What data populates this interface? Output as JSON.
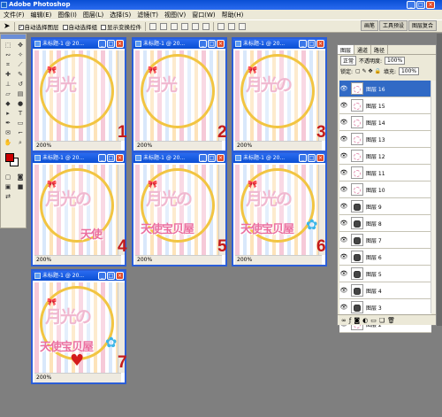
{
  "app": {
    "title": "Adobe Photoshop"
  },
  "window_controls": [
    "_",
    "□",
    "×"
  ],
  "menu": [
    "文件(F)",
    "编辑(E)",
    "图像(I)",
    "图层(L)",
    "选择(S)",
    "滤镜(T)",
    "视图(V)",
    "窗口(W)",
    "帮助(H)"
  ],
  "options": {
    "auto_select_layer": "自动选择图层",
    "auto_select_group": "自动选择组",
    "show_transform": "显示变换控件"
  },
  "wells": [
    "画笔",
    "工具预设",
    "图层复合"
  ],
  "documents": [
    {
      "title": "未标题-1 @ 20...",
      "zoom": "200%",
      "label": "1",
      "line1": "月光",
      "line2": "",
      "flower": false,
      "heart": false
    },
    {
      "title": "未标题-1 @ 20...",
      "zoom": "200%",
      "label": "2",
      "line1": "月光",
      "line2": "",
      "flower": false,
      "heart": false
    },
    {
      "title": "未标题-1 @ 20...",
      "zoom": "200%",
      "label": "3",
      "line1": "月光の",
      "line2": "",
      "flower": false,
      "heart": false
    },
    {
      "title": "未标题-1 @ 20...",
      "zoom": "200%",
      "label": "4",
      "line1": "月光の",
      "line2": "天使",
      "flower": false,
      "heart": false
    },
    {
      "title": "未标题-1 @ 20...",
      "zoom": "200%",
      "label": "5",
      "line1": "月光の",
      "line2": "天使宝贝屋",
      "flower": false,
      "heart": false
    },
    {
      "title": "未标题-1 @ 20...",
      "zoom": "200%",
      "label": "6",
      "line1": "月光の",
      "line2": "天使宝贝屋",
      "flower": true,
      "heart": false
    },
    {
      "title": "未标题-1 @ 20...",
      "zoom": "200%",
      "label": "7",
      "line1": "月光の",
      "line2": "天使宝贝屋",
      "flower": true,
      "heart": true
    }
  ],
  "layers_panel": {
    "tabs": [
      "图层",
      "通道",
      "路径"
    ],
    "blend_mode": "正常",
    "opacity_label": "不透明度:",
    "opacity": "100%",
    "lock_label": "锁定:",
    "fill_label": "填充:",
    "fill": "100%",
    "layers": [
      {
        "name": "图层 16",
        "selected": true,
        "dark": false
      },
      {
        "name": "图层 15",
        "selected": false,
        "dark": false
      },
      {
        "name": "图层 14",
        "selected": false,
        "dark": false
      },
      {
        "name": "图层 13",
        "selected": false,
        "dark": false
      },
      {
        "name": "图层 12",
        "selected": false,
        "dark": false
      },
      {
        "name": "图层 11",
        "selected": false,
        "dark": false
      },
      {
        "name": "图层 10",
        "selected": false,
        "dark": false
      },
      {
        "name": "图层 9",
        "selected": false,
        "dark": true
      },
      {
        "name": "图层 8",
        "selected": false,
        "dark": true
      },
      {
        "name": "图层 7",
        "selected": false,
        "dark": true
      },
      {
        "name": "图层 6",
        "selected": false,
        "dark": true
      },
      {
        "name": "图层 5",
        "selected": false,
        "dark": true
      },
      {
        "name": "图层 4",
        "selected": false,
        "dark": true
      },
      {
        "name": "图层 3",
        "selected": false,
        "dark": true
      },
      {
        "name": "图层 2",
        "selected": false,
        "dark": false
      }
    ]
  }
}
